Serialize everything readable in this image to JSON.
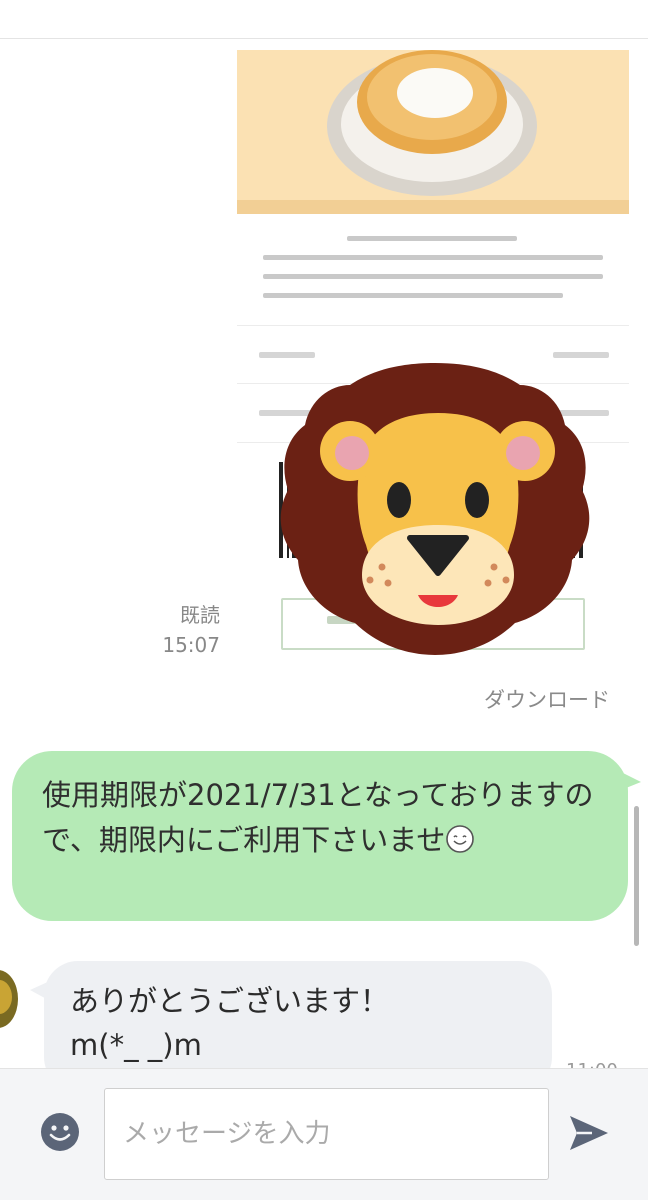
{
  "chat": {
    "read_label": "既読",
    "read_time": "15:07",
    "download_label": "ダウンロード",
    "outgoing_message": "使用期限が2021/7/31となっておりますので、期限内にご利用下さいませ",
    "outgoing_emoji": "smiling-face-emoji",
    "incoming_message_line1": "ありがとうございます！",
    "incoming_message_line2": "m(*_ _)m",
    "incoming_time_partial": "11:00"
  },
  "composer": {
    "placeholder": "メッセージを入力"
  },
  "icons": {
    "emoji": "smiley-icon",
    "send": "send-icon",
    "sticker": "lion-face-emoji"
  },
  "colors": {
    "outgoing_bubble": "#b5eab6",
    "incoming_bubble": "#eef0f3",
    "send_icon": "#5b6578"
  }
}
